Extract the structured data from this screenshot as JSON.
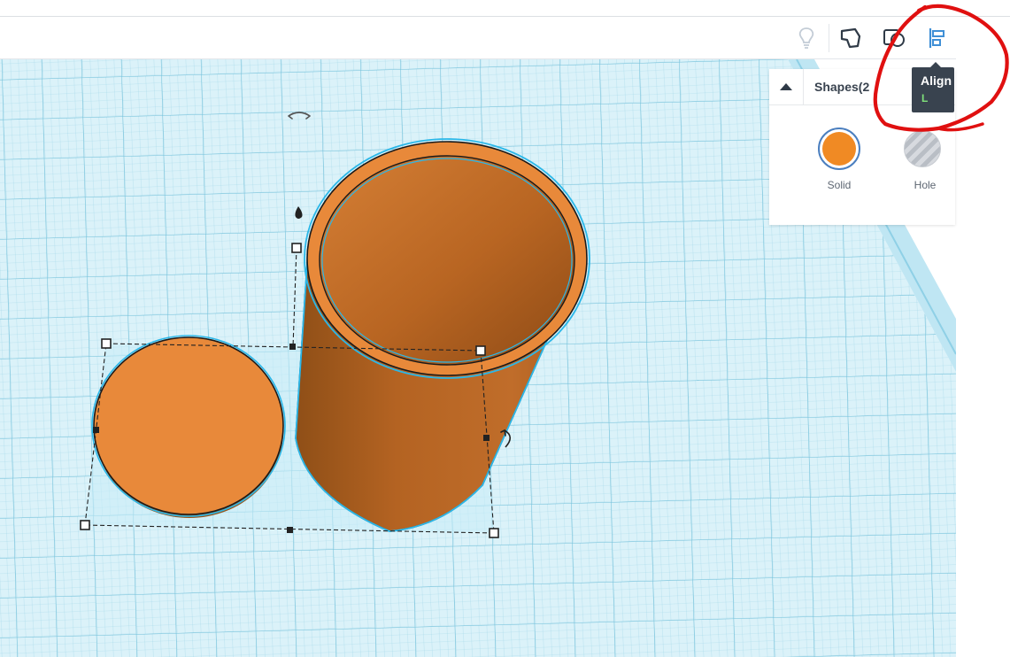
{
  "toolbar": {
    "tools": [
      {
        "name": "lightbulb-icon"
      },
      {
        "name": "note-icon"
      },
      {
        "name": "view-icon"
      },
      {
        "name": "align-icon"
      }
    ]
  },
  "inspector": {
    "title": "Shapes(2",
    "solid_label": "Solid",
    "hole_label": "Hole",
    "colors": {
      "solid": "#f08a24",
      "hole": "#b9bec5"
    }
  },
  "tooltip": {
    "title": "Align",
    "shortcut": "L"
  },
  "workplane": {
    "grid_color": "#7cc8e0",
    "plane_color": "#d9f1f8",
    "shape_color": "#e8893a",
    "selection_outline": "#2bb7e8",
    "annotation_color": "#e01010"
  }
}
